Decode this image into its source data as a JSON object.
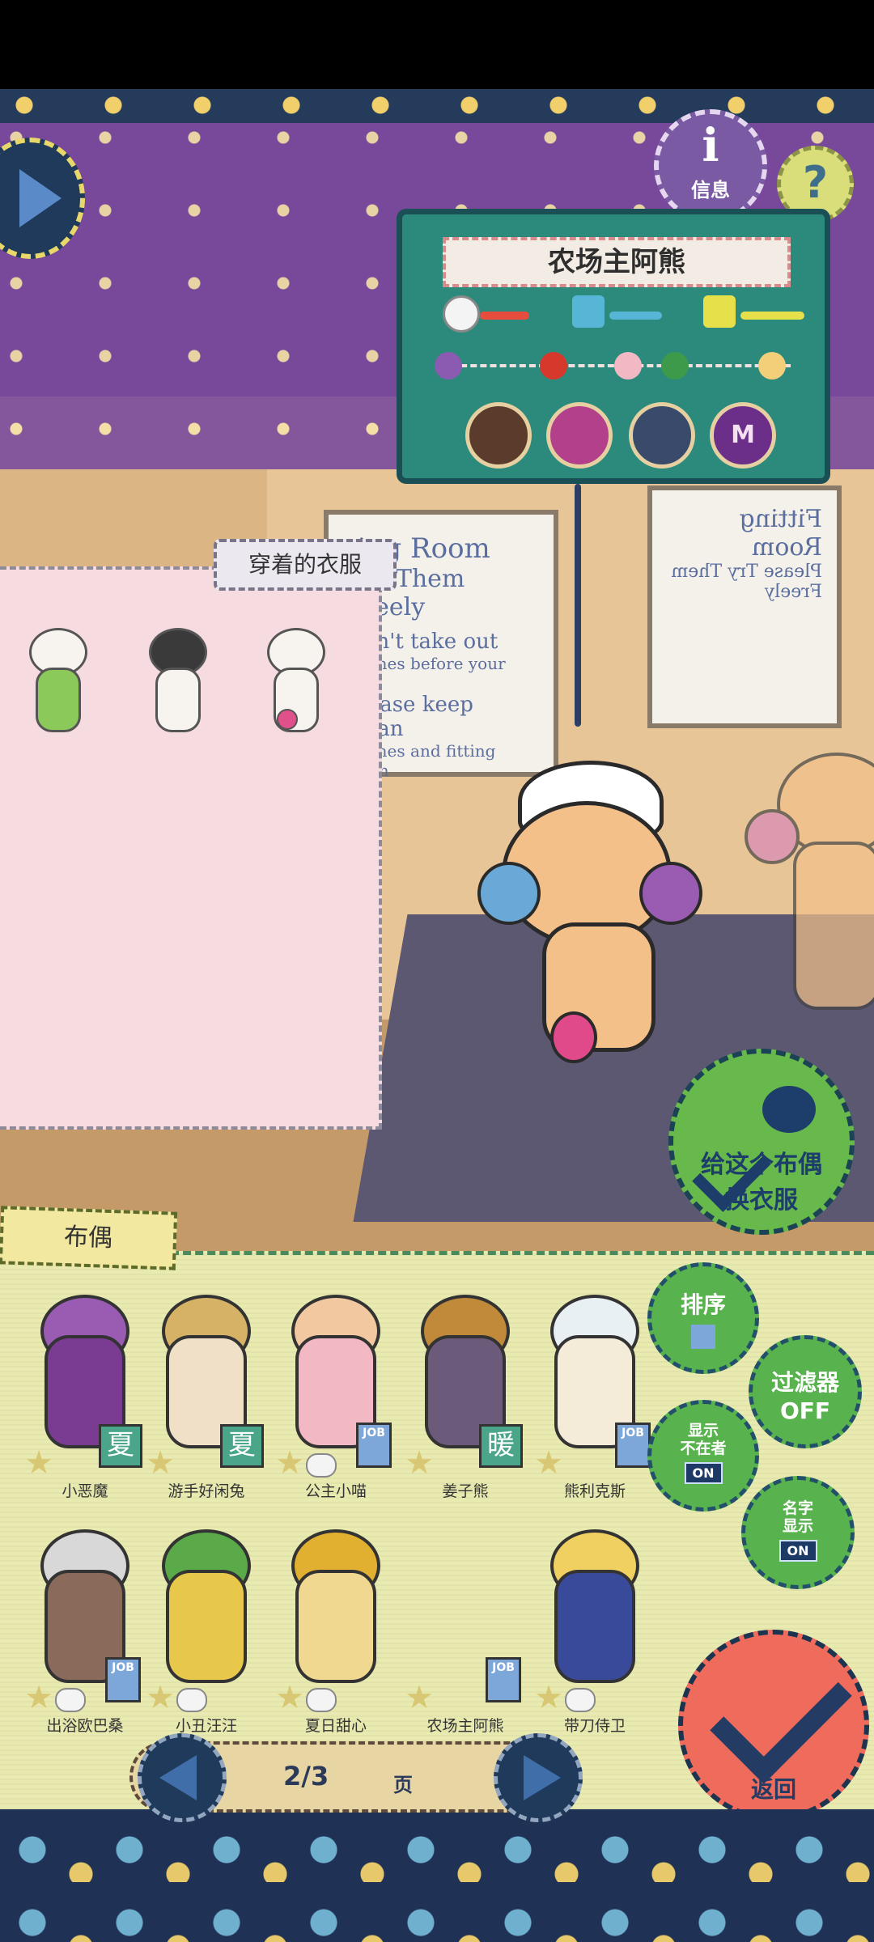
{
  "info_button": {
    "icon": "info-icon",
    "label": "信息"
  },
  "help_button": {
    "icon": "question-icon",
    "label": "?"
  },
  "next_arrow": {
    "icon": "arrow-right-icon"
  },
  "doll_card": {
    "name": "农场主阿熊",
    "stats": [
      {
        "icon": "chef-hat-icon",
        "color": "#e84c3d",
        "level": 0.45
      },
      {
        "icon": "book-icon",
        "color": "#57b6d6",
        "level": 0.5
      },
      {
        "icon": "horn-icon",
        "color": "#e6e04a",
        "level": 0.65
      }
    ],
    "emotions": [
      "broken-heart-icon",
      "chili-icon",
      "lollipop-icon",
      "leaf-icon",
      "pig-icon"
    ],
    "job_icons": [
      {
        "icon": "table-icon",
        "color": "#5b3b2b",
        "text": ""
      },
      {
        "icon": "chef-hat-icon",
        "color": "#b3408a",
        "text": ""
      },
      {
        "icon": "fitness-icon",
        "color": "#3a4a6a",
        "text": ""
      },
      {
        "icon": "m-icon",
        "color": "#6b2f8a",
        "text": "M"
      }
    ]
  },
  "fitting_room_sign": {
    "title": "ting Room",
    "line1": "Try Them Freely",
    "line2": "Don't take out",
    "line3": "clothes before your bill.",
    "line4": "Please keep clean",
    "line5": "clothes and fitting room"
  },
  "fitting_room_sign_mirror": {
    "title": "Fitting Room",
    "line1": "Please Try Them Freely"
  },
  "worn_clothes": {
    "tab_label": "穿着的衣服",
    "items": [
      {
        "name": "worn-outfit-1",
        "accent": "#8ac95a"
      },
      {
        "name": "worn-outfit-2",
        "accent": "#4a4a4a"
      },
      {
        "name": "worn-outfit-3",
        "accent": "#e0508a"
      }
    ]
  },
  "change_button": {
    "label_line1": "给这个布偶",
    "label_line2": "换衣服"
  },
  "doll_list": {
    "tab_label": "布偶",
    "dolls": [
      {
        "name": "小恶魔",
        "color": "#9a5bb2",
        "badge": "夏",
        "badge_type": "season"
      },
      {
        "name": "游手好闲兔",
        "color": "#f0e0c8",
        "badge": "夏",
        "badge_type": "season"
      },
      {
        "name": "公主小喵",
        "color": "#f2b8c4",
        "badge": "JOB",
        "badge_type": "job"
      },
      {
        "name": "姜子熊",
        "color": "#6b5a7a",
        "badge": "暖",
        "badge_type": "season"
      },
      {
        "name": "熊利克斯",
        "color": "#e8f0f4",
        "badge": "JOB",
        "badge_type": "job"
      },
      {
        "name": "出浴欧巴桑",
        "color": "#8a6a5a",
        "badge": "JOB",
        "badge_type": "job"
      },
      {
        "name": "小丑汪汪",
        "color": "#e8c84a",
        "badge": "",
        "badge_type": "none"
      },
      {
        "name": "夏日甜心",
        "color": "#f0d890",
        "badge": "",
        "badge_type": "none"
      },
      {
        "name": "农场主阿熊",
        "color": "#e9eab0",
        "badge": "JOB",
        "badge_type": "job"
      },
      {
        "name": "带刀侍卫",
        "color": "#3a4a9a",
        "badge": "",
        "badge_type": "none"
      }
    ]
  },
  "side_buttons": {
    "sort": {
      "label": "排序"
    },
    "filter": {
      "label": "过滤器",
      "state": "OFF"
    },
    "show_absent": {
      "label_line1": "显示",
      "label_line2": "不在者",
      "state": "ON"
    },
    "show_names": {
      "label_line1": "名字",
      "label_line2": "显示",
      "state": "ON"
    }
  },
  "confirm_button": {
    "label": "返回"
  },
  "pagination": {
    "page": "2/3",
    "unit": "页"
  }
}
